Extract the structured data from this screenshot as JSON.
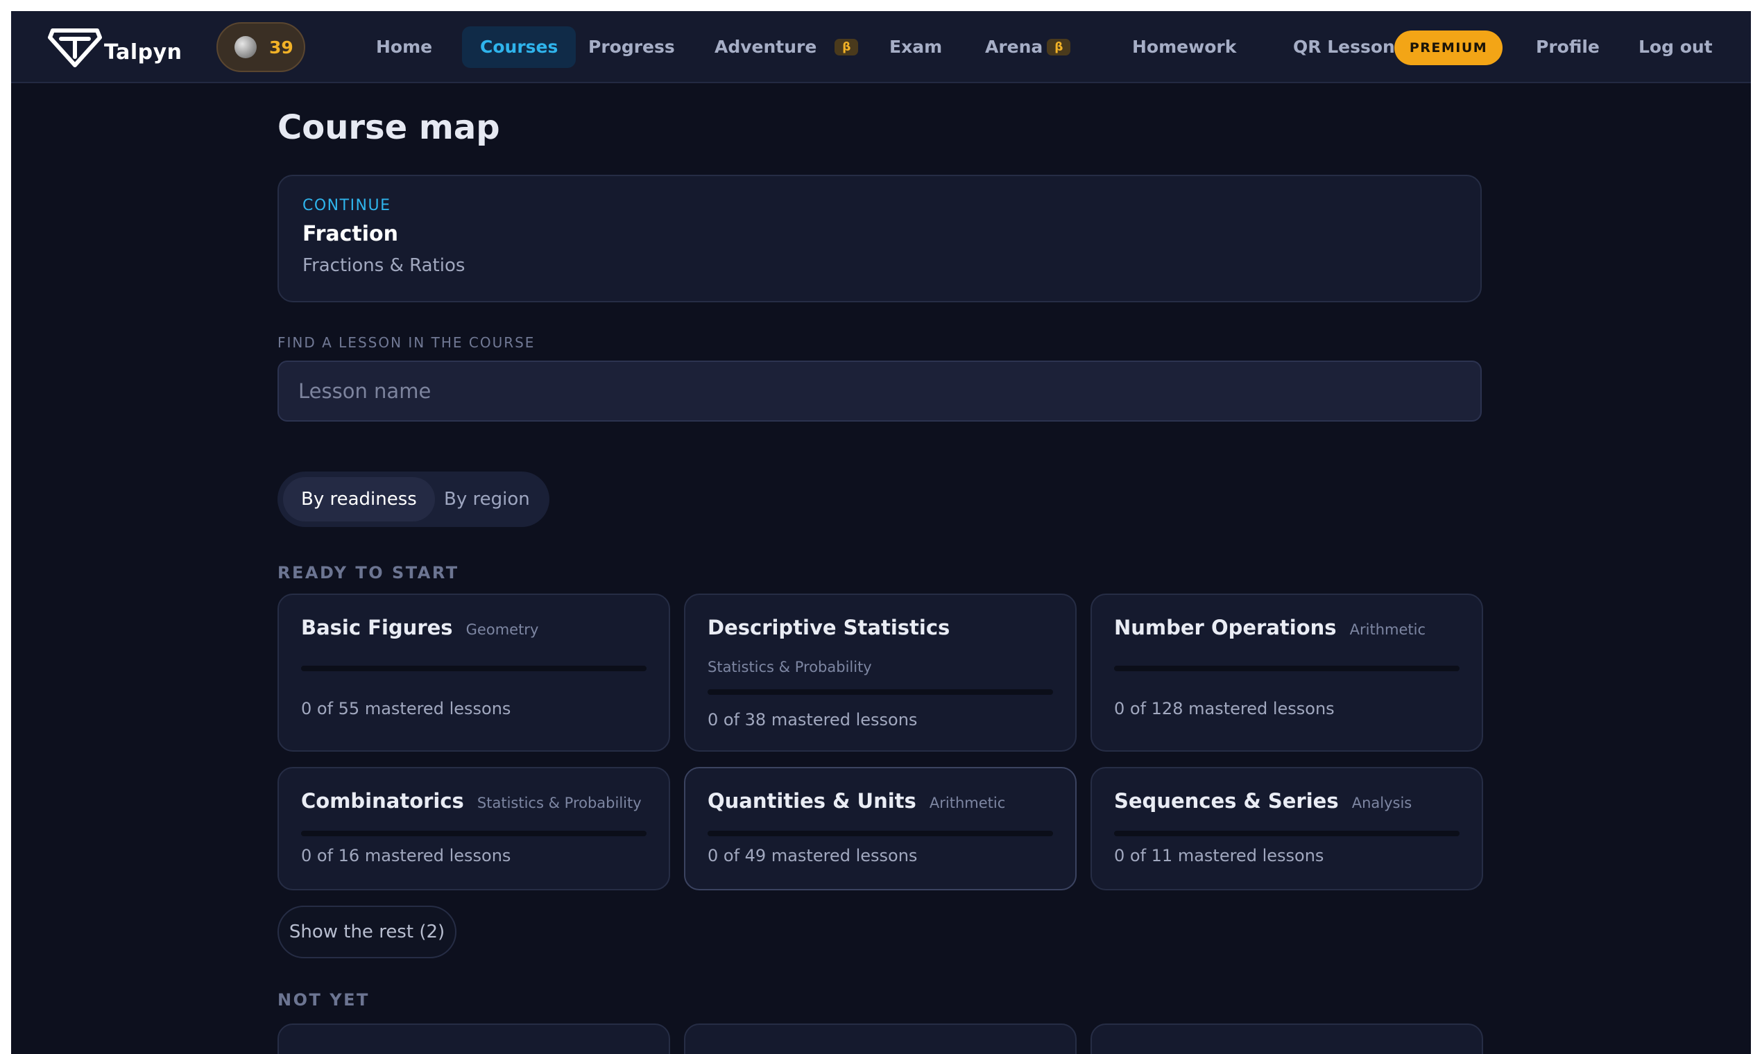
{
  "header": {
    "brand": "Talpyn",
    "coins": "39",
    "nav": {
      "home": "Home",
      "courses": "Courses",
      "progress": "Progress",
      "adventure": "Adventure",
      "exam": "Exam",
      "arena": "Arena",
      "homework": "Homework",
      "qr_lesson": "QR Lesson",
      "premium": "PREMIUM",
      "profile": "Profile",
      "logout": "Log out"
    },
    "beta_badge": "β",
    "active_tab": "Courses"
  },
  "page": {
    "title": "Course map"
  },
  "continue_card": {
    "label": "CONTINUE",
    "lesson": "Fraction",
    "course": "Fractions & Ratios"
  },
  "search": {
    "label": "FIND A LESSON IN THE COURSE",
    "placeholder": "Lesson name",
    "value": ""
  },
  "view_toggle": {
    "by_readiness": "By readiness",
    "by_region": "By region",
    "selected": "By readiness"
  },
  "sections": {
    "ready": "READY TO START",
    "not_yet": "NOT YET"
  },
  "ready_courses": [
    {
      "title": "Basic Figures",
      "tag": "Geometry",
      "mastered": 0,
      "total": 55,
      "progress_text": "0 of 55 mastered lessons"
    },
    {
      "title": "Descriptive Statistics",
      "tag": "Statistics & Probability",
      "mastered": 0,
      "total": 38,
      "progress_text": "0 of 38 mastered lessons"
    },
    {
      "title": "Number Operations",
      "tag": "Arithmetic",
      "mastered": 0,
      "total": 128,
      "progress_text": "0 of 128 mastered lessons"
    },
    {
      "title": "Combinatorics",
      "tag": "Statistics & Probability",
      "mastered": 0,
      "total": 16,
      "progress_text": "0 of 16 mastered lessons"
    },
    {
      "title": "Quantities & Units",
      "tag": "Arithmetic",
      "mastered": 0,
      "total": 49,
      "progress_text": "0 of 49 mastered lessons"
    },
    {
      "title": "Sequences & Series",
      "tag": "Analysis",
      "mastered": 0,
      "total": 11,
      "progress_text": "0 of 11 mastered lessons"
    }
  ],
  "show_rest_label": "Show the rest (2)",
  "colors": {
    "background": "#0d101e",
    "card": "#151a2e",
    "accent": "#2fb4ec",
    "premium": "#f3a516",
    "coins": "#f2b227"
  }
}
